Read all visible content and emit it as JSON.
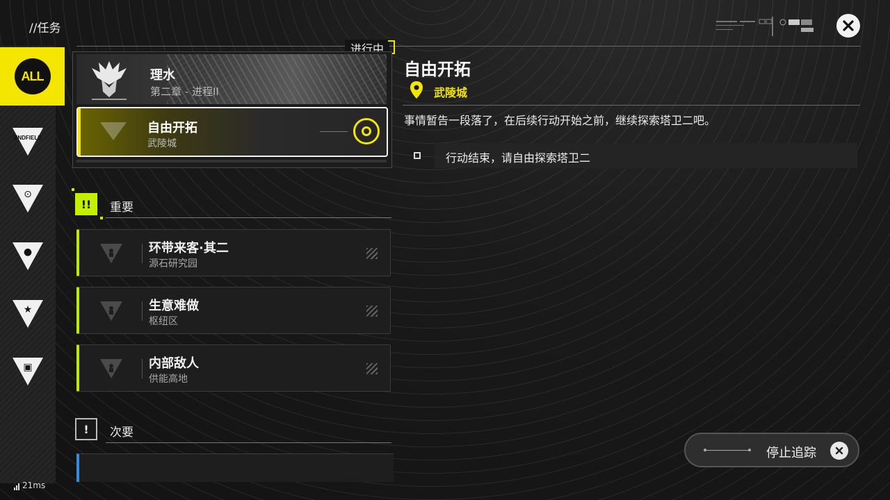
{
  "header": {
    "breadcrumb": "//任务",
    "status_label": "进行中",
    "close_icon": "close-icon"
  },
  "sidebar": {
    "items": [
      {
        "id": "all",
        "label": "ALL",
        "active": true
      },
      {
        "id": "endfield",
        "label": "ENDFIELD",
        "icon": "endfield-icon"
      },
      {
        "id": "explore",
        "icon": "compass-icon"
      },
      {
        "id": "person",
        "icon": "person-icon"
      },
      {
        "id": "star",
        "icon": "star-icon"
      },
      {
        "id": "build",
        "icon": "building-icon"
      }
    ]
  },
  "tracked": {
    "chapter_title": "理水",
    "chapter_sub": "第二章 - 进程II",
    "selected_title": "自由开拓",
    "selected_sub": "武陵城"
  },
  "sections": {
    "important_label": "重要",
    "important_badge": "!!",
    "secondary_label": "次要",
    "secondary_badge": "!"
  },
  "quests": [
    {
      "title": "环带来客·其二",
      "sub": "源石研究园"
    },
    {
      "title": "生意难做",
      "sub": "枢纽区"
    },
    {
      "title": "内部敌人",
      "sub": "供能高地"
    }
  ],
  "detail": {
    "title": "自由开拓",
    "location": "武陵城",
    "description": "事情暂告一段落了，在后续行动开始之前，继续探索塔卫二吧。",
    "objective": "行动结束，请自由探索塔卫二"
  },
  "stop_tracking": {
    "label": "停止追踪"
  },
  "network": {
    "ping": "21ms"
  },
  "colors": {
    "accent_yellow": "#f5e600",
    "accent_lime": "#b8ec00",
    "bg": "#141414"
  }
}
